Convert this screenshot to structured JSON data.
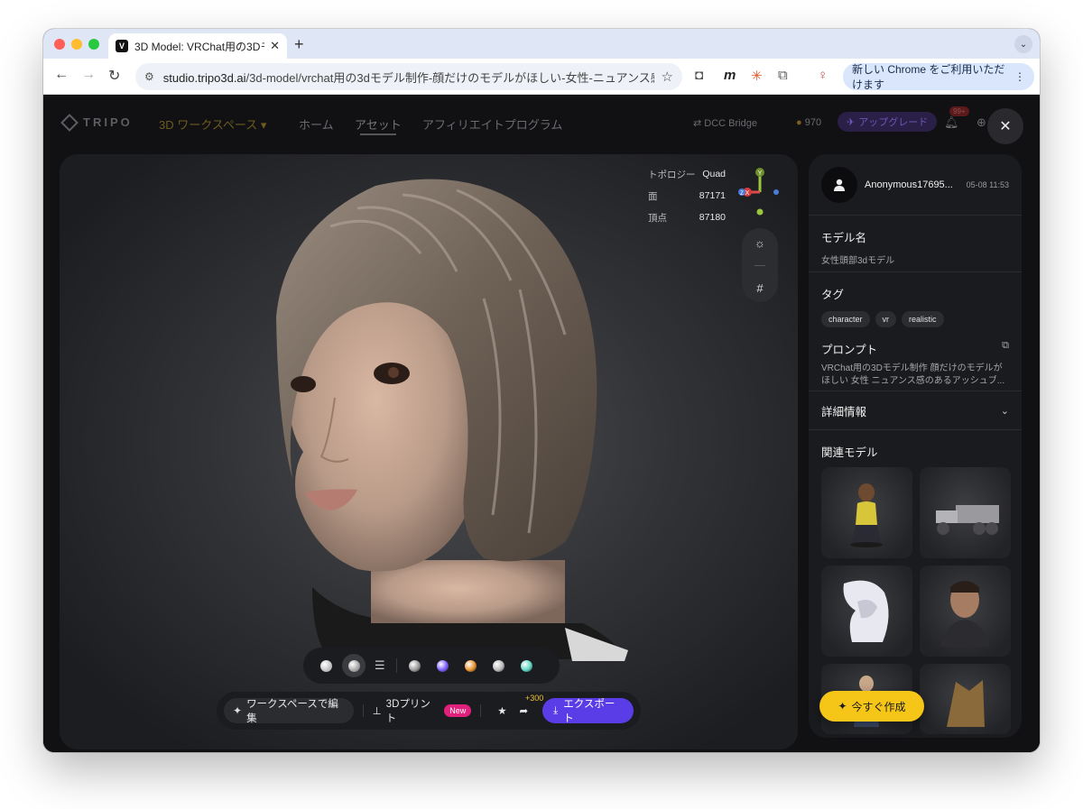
{
  "browser": {
    "tab_title": "3D Model: VRChat用の3Dモデ",
    "url_host": "studio.tripo3d.ai",
    "url_path": "/3d-model/vrchat用の3dモデル制作-顔だけのモデルがほしい-女性-ニュアンス感のあ...",
    "update_label": "新しい Chrome をご利用いただけます"
  },
  "header": {
    "logo": "TRIPO",
    "workspace": "3D ワークスペース",
    "nav": [
      "ホーム",
      "アセット",
      "アフィリエイトプログラム"
    ],
    "active_nav": "アセット",
    "dcc_bridge": "DCC Bridge",
    "credits": "970",
    "upgrade": "アップグレード",
    "notif_count": "99+"
  },
  "viewer": {
    "stats": [
      {
        "k": "トポロジー",
        "v": "Quad"
      },
      {
        "k": "面",
        "v": "87171"
      },
      {
        "k": "頂点",
        "v": "87180"
      }
    ],
    "gizmo": {
      "y": "Y",
      "x": "X",
      "z": "Z"
    },
    "materials": [
      "#d8d8d8",
      "#9a9a9a",
      "#7b5cff",
      "#e8902a",
      "#b9b9b9",
      "#5fd6c4"
    ],
    "actions": {
      "edit": "ワークスペースで編集",
      "print": "3Dプリント",
      "new_badge": "New",
      "share_bonus": "+300",
      "export": "エクスポート"
    }
  },
  "panel": {
    "user": "Anonymous17695...",
    "date": "05-08 11:53",
    "model_name_label": "モデル名",
    "model_name": "女性頭部3dモデル",
    "tags_label": "タグ",
    "tags": [
      "character",
      "vr",
      "realistic"
    ],
    "prompt_label": "プロンプト",
    "prompt": "VRChat用の3Dモデル制作 顔だけのモデルがほしい 女性 ニュアンス感のあるアッシュブ...",
    "details_label": "詳細情報",
    "related_label": "関連モデル",
    "create_now": "今すぐ作成"
  },
  "colors": {
    "accent_purple": "#5b3de8",
    "cta_yellow": "#f5c518",
    "new_badge": "#e0207a"
  }
}
